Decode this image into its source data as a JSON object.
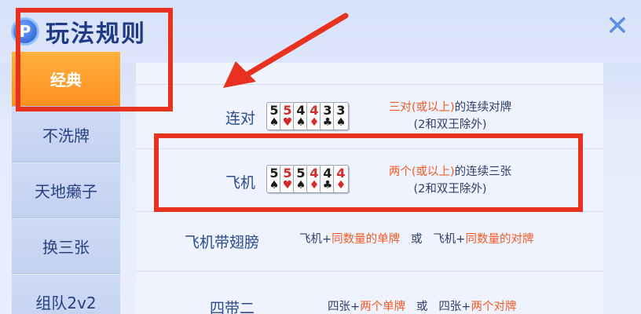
{
  "title": "玩法规则",
  "title_icon": "P",
  "sidebar": {
    "items": [
      {
        "label": "经典",
        "active": true
      },
      {
        "label": "不洗牌",
        "active": false
      },
      {
        "label": "天地癞子",
        "active": false
      },
      {
        "label": "换三张",
        "active": false
      },
      {
        "label": "组队2v2",
        "active": false
      }
    ]
  },
  "rows": [
    {
      "name": "连对",
      "cards": [
        {
          "rank": "5",
          "suit": "♠",
          "color": "black"
        },
        {
          "rank": "5",
          "suit": "♥",
          "color": "red"
        },
        {
          "rank": "4",
          "suit": "♠",
          "color": "black"
        },
        {
          "rank": "4",
          "suit": "♦",
          "color": "red"
        },
        {
          "rank": "3",
          "suit": "♣",
          "color": "black"
        },
        {
          "rank": "3",
          "suit": "♠",
          "color": "black"
        }
      ],
      "desc_highlight": "三对(或以上)",
      "desc_plain": "的连续对牌",
      "desc_line2": "(2和双王除外)"
    },
    {
      "name": "飞机",
      "cards": [
        {
          "rank": "5",
          "suit": "♠",
          "color": "black"
        },
        {
          "rank": "5",
          "suit": "♥",
          "color": "red"
        },
        {
          "rank": "5",
          "suit": "♠",
          "color": "black"
        },
        {
          "rank": "4",
          "suit": "♦",
          "color": "red"
        },
        {
          "rank": "4",
          "suit": "♣",
          "color": "black"
        },
        {
          "rank": "4",
          "suit": "♦",
          "color": "red"
        }
      ],
      "desc_highlight": "两个(或以上)",
      "desc_plain": "的连续三张",
      "desc_line2": "(2和双王除外)"
    },
    {
      "name": "飞机带翅膀",
      "part1": "飞机+",
      "part1_hl": "同数量的单牌",
      "or": "或",
      "part2": "飞机+",
      "part2_hl": "同数量的对牌"
    },
    {
      "name": "四带二",
      "part1": "四张+",
      "part1_hl": "两个单牌",
      "or": "或",
      "part2": "四张+",
      "part2_hl": "两个对牌"
    }
  ],
  "colors": {
    "accent_orange": "#ff9b2c",
    "highlight_text": "#f25a24",
    "annotation_red": "#e8321f"
  },
  "icons": {
    "close": "close-x-icon",
    "title": "p-coin-icon"
  }
}
